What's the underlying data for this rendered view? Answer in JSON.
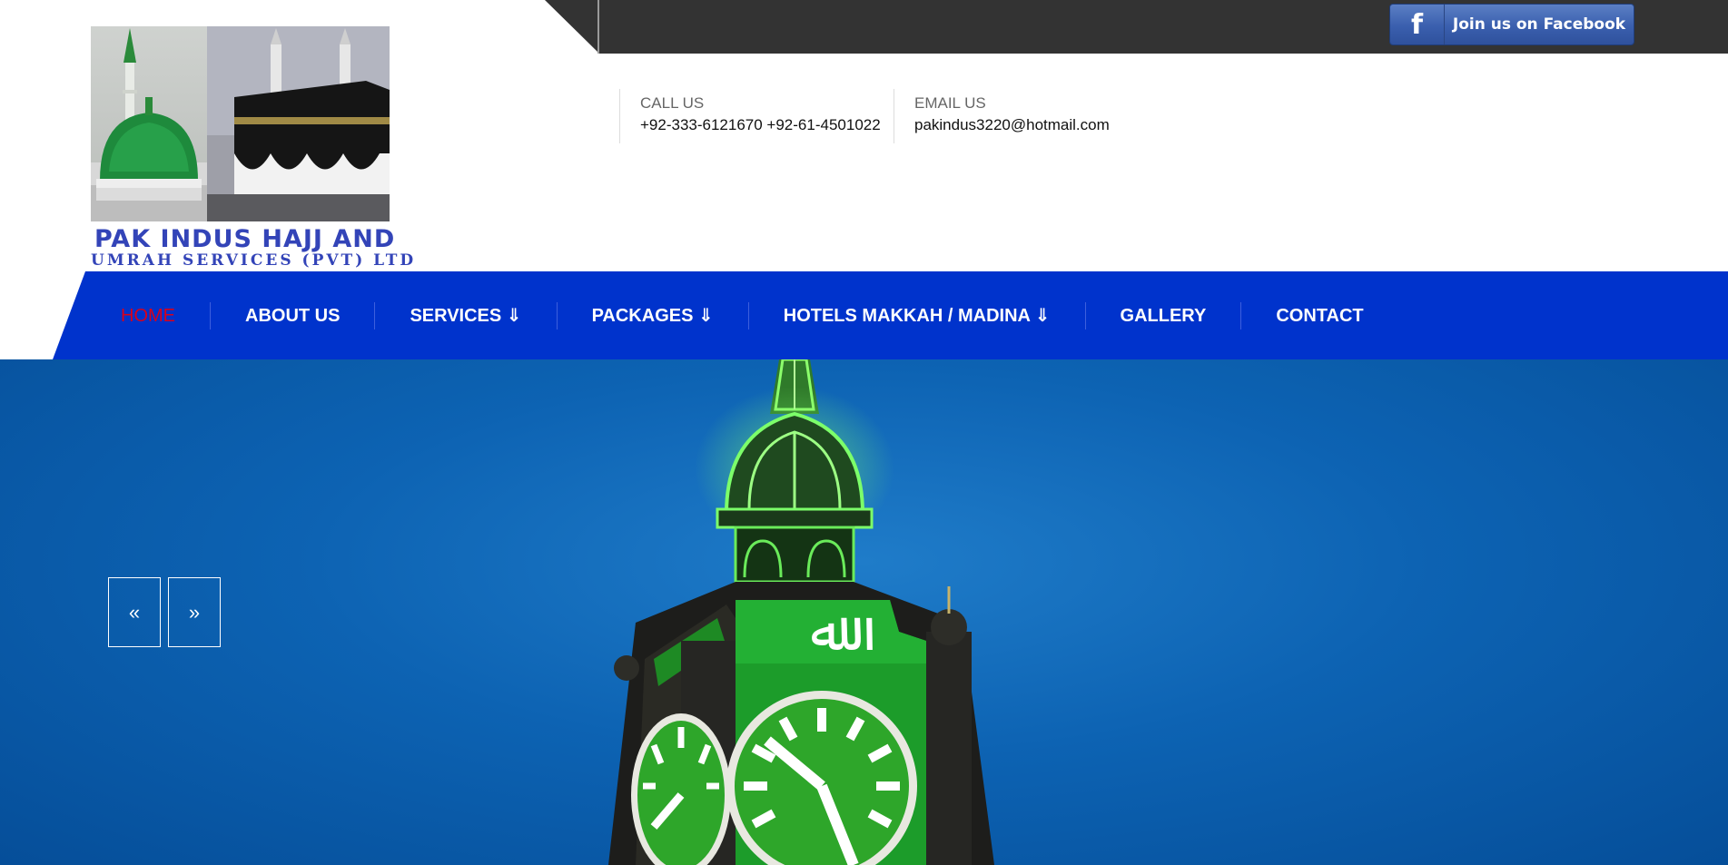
{
  "header": {
    "facebook_button": {
      "icon": "facebook-icon",
      "icon_glyph": "f",
      "label": "Join us on Facebook"
    },
    "logo": {
      "line1": "PAK INDUS HAJJ AND",
      "line2": "UMRAH SERVICES (PVT) LTD"
    },
    "call": {
      "label": "CALL US",
      "value": "+92-333-6121670 +92-61-4501022"
    },
    "email": {
      "label": "EMAIL US",
      "value": "pakindus3220@hotmail.com"
    }
  },
  "nav": {
    "items": [
      {
        "label": "HOME",
        "active": true
      },
      {
        "label": "ABOUT US"
      },
      {
        "label": "SERVICES ⇓"
      },
      {
        "label": "PACKAGES ⇓"
      },
      {
        "label": "HOTELS MAKKAH / MADINA ⇓"
      },
      {
        "label": "GALLERY"
      },
      {
        "label": "CONTACT"
      }
    ]
  },
  "slider": {
    "prev_label": "«",
    "next_label": "»"
  },
  "colors": {
    "nav_bg": "#0033cc",
    "nav_active": "#d9001b",
    "topbar": "#333333",
    "logo_text": "#3344b8",
    "hero_sky": "#0d63b3"
  }
}
